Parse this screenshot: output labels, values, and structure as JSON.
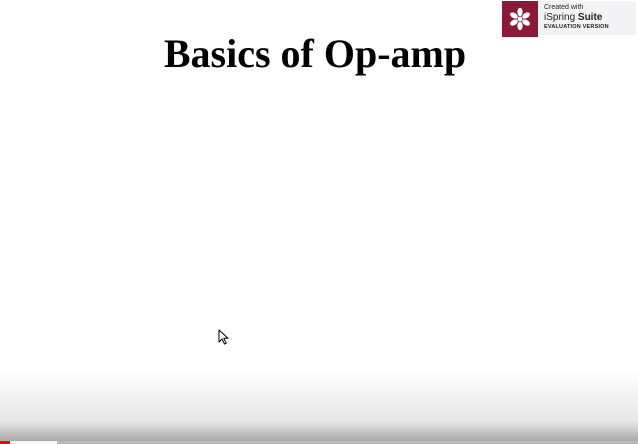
{
  "slide": {
    "title": "Basics of Op-amp"
  },
  "watermark": {
    "line1": "Created with",
    "brand_first": "iSpring ",
    "brand_second": "Suite",
    "line3": "EVALUATION VERSION",
    "logo_color": "#8b1a3a"
  },
  "player": {
    "progress_played_fraction": 0.015,
    "progress_buffered_fraction": 0.09,
    "progress_color": "#ff0000"
  },
  "icons": {
    "logo": "ispring-flower-icon",
    "cursor": "mouse-pointer-icon"
  }
}
